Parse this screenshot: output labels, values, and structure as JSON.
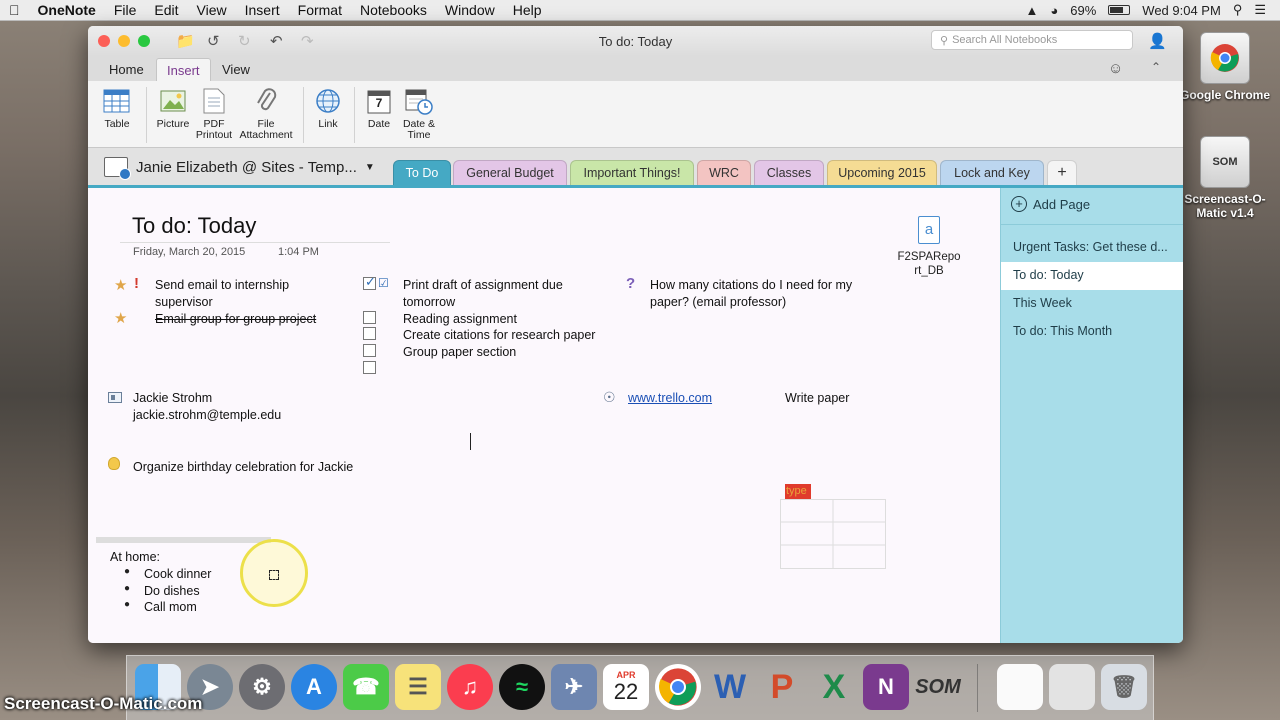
{
  "menubar": {
    "apple": "",
    "app_name": "OneNote",
    "items": [
      "File",
      "Edit",
      "View",
      "Insert",
      "Format",
      "Notebooks",
      "Window",
      "Help"
    ],
    "battery": "69%",
    "clock": "Wed 9:04 PM"
  },
  "desktop": {
    "icons": [
      {
        "label": "Google Chrome",
        "glyph": "chrome-icon"
      },
      {
        "label": "Screencast-O-Matic v1.4",
        "glyph": "som-icon",
        "badge": "SOM"
      }
    ]
  },
  "window": {
    "title": "To do: Today",
    "search_placeholder": "Search All Notebooks",
    "ribbon_tabs": [
      "Home",
      "Insert",
      "View"
    ],
    "active_tab": "Insert",
    "ribbon_buttons": [
      {
        "label": "Table",
        "icon": "table-icon"
      },
      {
        "label": "Picture",
        "icon": "picture-icon"
      },
      {
        "label": "PDF Printout",
        "icon": "pdf-icon"
      },
      {
        "label": "File Attachment",
        "icon": "paperclip-icon"
      },
      {
        "label": "Link",
        "icon": "globe-link-icon"
      },
      {
        "label": "Date",
        "icon": "calendar-icon",
        "badge": "7"
      },
      {
        "label": "Date & Time",
        "icon": "calendar-clock-icon"
      }
    ]
  },
  "notebook": {
    "name": "Janie Elizabeth @ Sites - Temp...",
    "sections": [
      {
        "label": "To Do",
        "color": "#45a9c4",
        "active": true
      },
      {
        "label": "General Budget",
        "color": "#e3c6e7"
      },
      {
        "label": "Important Things!",
        "color": "#c9e6a8"
      },
      {
        "label": "WRC",
        "color": "#f3c4c2"
      },
      {
        "label": "Classes",
        "color": "#e3c6e7"
      },
      {
        "label": "Upcoming 2015",
        "color": "#f5dc94"
      },
      {
        "label": "Lock and Key",
        "color": "#bcd6ef"
      }
    ],
    "add_section": "+"
  },
  "page": {
    "title": "To do: Today",
    "date": "Friday, March 20, 2015",
    "time": "1:04 PM",
    "attachment": {
      "name": "F2SPARepo rt_DB",
      "icon": "file-attachment-icon"
    },
    "important_items": [
      "Send email to internship supervisor",
      "Email group for group project"
    ],
    "checklist": [
      {
        "text": "Print draft of assignment due tomorrow",
        "checked": true
      },
      {
        "text": "Reading assignment",
        "checked": false
      },
      {
        "text": "Create citations for research paper",
        "checked": false
      },
      {
        "text": "Group paper section",
        "checked": false
      },
      {
        "text": "",
        "checked": false
      }
    ],
    "question": "How many citations do I need for my paper? (email professor)",
    "contact": {
      "name": "Jackie Strohm",
      "email": "jackie.strohm@temple.edu"
    },
    "link": "www.trello.com",
    "write_paper": "Write paper",
    "idea": "Organize birthday celebration for Jackie",
    "table_header": "type",
    "home_list": {
      "heading": "At home:",
      "items": [
        "Cook dinner",
        "Do dishes",
        "Call mom"
      ]
    }
  },
  "pages_pane": {
    "add_page": "Add Page",
    "pages": [
      {
        "label": "Urgent Tasks: Get these d..."
      },
      {
        "label": "To do: Today",
        "selected": true
      },
      {
        "label": "This Week"
      },
      {
        "label": "To do: This Month"
      }
    ]
  },
  "dock": {
    "date_icon_month": "APR",
    "date_icon_day": "22"
  },
  "watermark": "Screencast-O-Matic.com"
}
